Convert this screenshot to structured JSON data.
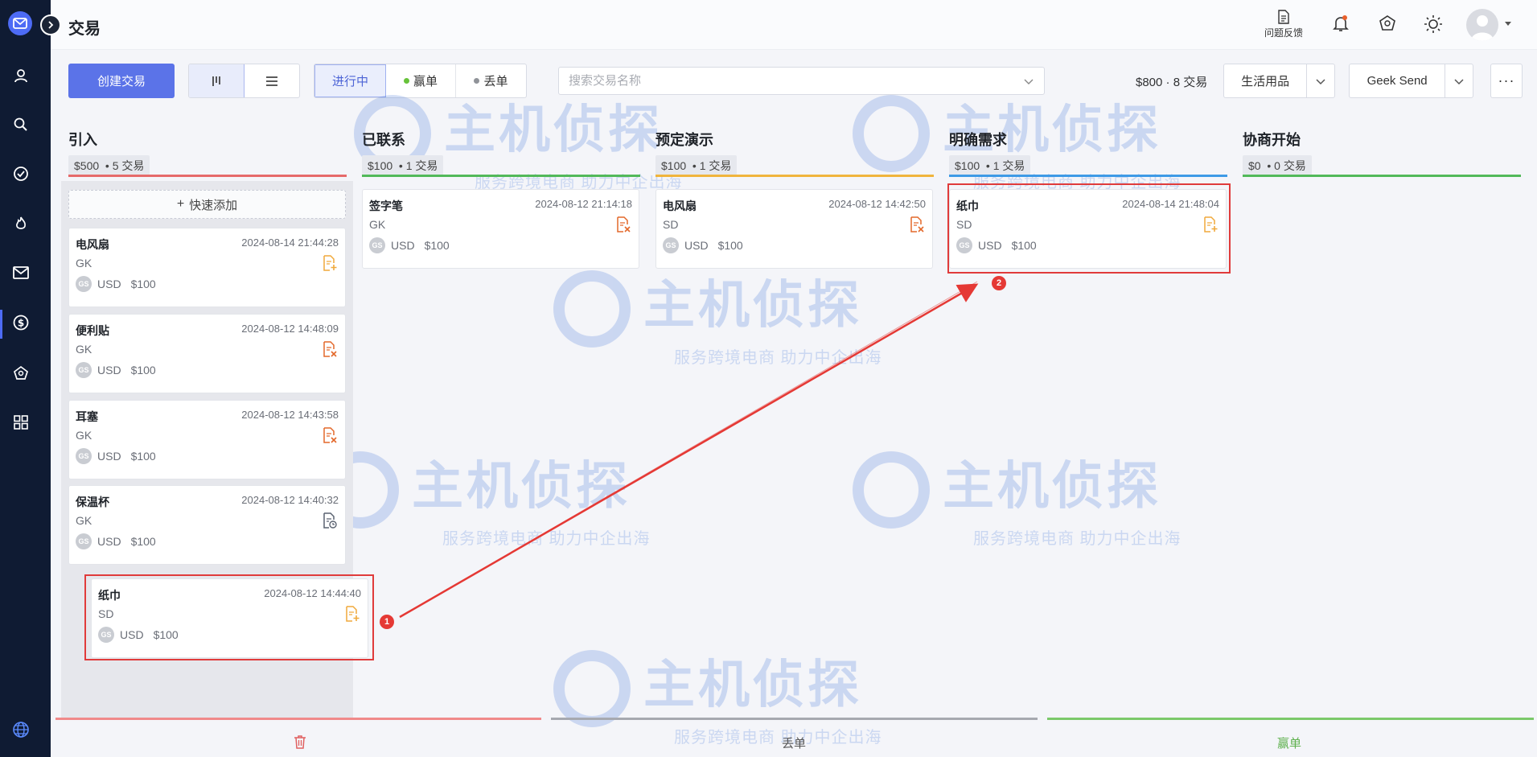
{
  "header": {
    "title": "交易",
    "feedback_label": "问题反馈"
  },
  "toolbar": {
    "create_label": "创建交易",
    "status_tabs": [
      {
        "label": "进行中"
      },
      {
        "label": "赢单",
        "dot": "#67c23a"
      },
      {
        "label": "丢单",
        "dot": "#909399"
      }
    ],
    "search_placeholder": "搜索交易名称",
    "summary": "$800 · 8 交易",
    "category_select": "生活用品",
    "account_select": "Geek Send",
    "more_label": "···"
  },
  "columns": [
    {
      "title": "引入",
      "amount": "$500",
      "count": "5 交易",
      "color": "#e66a6a"
    },
    {
      "title": "已联系",
      "amount": "$100",
      "count": "1 交易",
      "color": "#52b95a"
    },
    {
      "title": "预定演示",
      "amount": "$100",
      "count": "1 交易",
      "color": "#f0b43c"
    },
    {
      "title": "明确需求",
      "amount": "$100",
      "count": "1 交易",
      "color": "#3e9ae6"
    },
    {
      "title": "协商开始",
      "amount": "$0",
      "count": "0 交易",
      "color": "#52b95a"
    }
  ],
  "quick_add": "快速添加",
  "cards": [
    {
      "name": "电风扇",
      "date": "2024-08-14 21:44:28",
      "owner": "GK",
      "currency": "USD",
      "amount": "$100",
      "icon": "file-add-icon"
    },
    {
      "name": "便利贴",
      "date": "2024-08-12 14:48:09",
      "owner": "GK",
      "currency": "USD",
      "amount": "$100",
      "icon": "file-remove-icon"
    },
    {
      "name": "耳塞",
      "date": "2024-08-12 14:43:58",
      "owner": "GK",
      "currency": "USD",
      "amount": "$100",
      "icon": "file-remove-icon"
    },
    {
      "name": "保温杯",
      "date": "2024-08-12 14:40:32",
      "owner": "GK",
      "currency": "USD",
      "amount": "$100",
      "icon": "file-clock-icon"
    },
    {
      "name": "纸巾",
      "date": "2024-08-12 14:44:40",
      "owner": "SD",
      "currency": "USD",
      "amount": "$100",
      "icon": "file-add-icon"
    },
    {
      "name": "签字笔",
      "date": "2024-08-12 21:14:18",
      "owner": "GK",
      "currency": "USD",
      "amount": "$100",
      "icon": "file-remove-icon"
    },
    {
      "name": "电风扇",
      "date": "2024-08-12 14:42:50",
      "owner": "SD",
      "currency": "USD",
      "amount": "$100",
      "icon": "file-remove-icon"
    },
    {
      "name": "纸巾",
      "date": "2024-08-14 21:48:04",
      "owner": "SD",
      "currency": "USD",
      "amount": "$100",
      "icon": "file-add-icon"
    }
  ],
  "avatar_initials": "GS",
  "markers": [
    "1",
    "2"
  ],
  "zones": {
    "lost_label": "丢单",
    "won_label": "赢单"
  },
  "watermark": {
    "main": "主机侦探",
    "sub": "服务跨境电商 助力中企出海"
  },
  "colors": {
    "primary": "#5b73e8",
    "sidebar": "#0f1b33",
    "highlight": "#e03b3b"
  }
}
